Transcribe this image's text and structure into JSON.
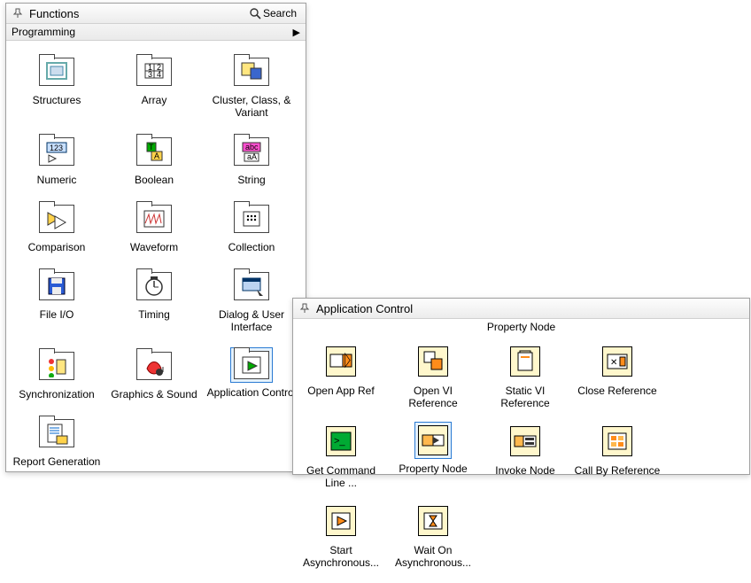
{
  "functionsPanel": {
    "title": "Functions",
    "searchLabel": "Search",
    "category": "Programming",
    "items": [
      {
        "label": "Structures",
        "icon": "structures"
      },
      {
        "label": "Array",
        "icon": "array"
      },
      {
        "label": "Cluster, Class, & Variant",
        "icon": "cluster"
      },
      {
        "label": "Numeric",
        "icon": "numeric"
      },
      {
        "label": "Boolean",
        "icon": "boolean"
      },
      {
        "label": "String",
        "icon": "string"
      },
      {
        "label": "Comparison",
        "icon": "comparison"
      },
      {
        "label": "Waveform",
        "icon": "waveform"
      },
      {
        "label": "Collection",
        "icon": "collection"
      },
      {
        "label": "File I/O",
        "icon": "fileio"
      },
      {
        "label": "Timing",
        "icon": "timing"
      },
      {
        "label": "Dialog & User Interface",
        "icon": "dialog"
      },
      {
        "label": "Synchronization",
        "icon": "sync"
      },
      {
        "label": "Graphics & Sound",
        "icon": "graphics"
      },
      {
        "label": "Application Control",
        "icon": "appctrl",
        "selected": true
      },
      {
        "label": "Report Generation",
        "icon": "report"
      }
    ]
  },
  "subPanel": {
    "title": "Application Control",
    "sectionLabel": "Property Node",
    "items": [
      {
        "label": "Open App Ref",
        "icon": "openapp"
      },
      {
        "label": "Open VI Reference",
        "icon": "openvi"
      },
      {
        "label": "Static VI Reference",
        "icon": "staticvi"
      },
      {
        "label": "Close Reference",
        "icon": "closeref"
      },
      {
        "label": "Get Command Line ...",
        "icon": "cmdline"
      },
      {
        "label": "Property Node",
        "icon": "propnode",
        "selected": true
      },
      {
        "label": "Invoke Node",
        "icon": "invoke"
      },
      {
        "label": "Call By Reference",
        "icon": "callbyref"
      },
      {
        "label": "Start Asynchronous...",
        "icon": "startasync"
      },
      {
        "label": "Wait On Asynchronous...",
        "icon": "waitasync"
      }
    ]
  }
}
